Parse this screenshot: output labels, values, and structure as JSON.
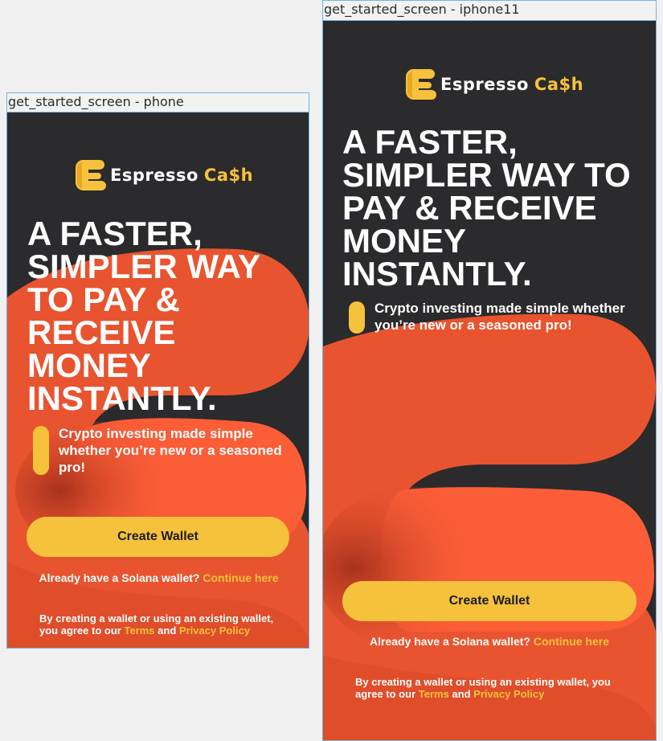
{
  "colors": {
    "accent": "#f6c23c",
    "background": "#2b2a2c",
    "wave": "#e8542f"
  },
  "frames": {
    "phone": {
      "label": "get_started_screen - phone"
    },
    "iphone11": {
      "label": "get_started_screen - iphone11"
    }
  },
  "logo": {
    "word1": "Espresso",
    "word2": "Ca$h",
    "icon": "espresso-cash-logo-icon"
  },
  "phone": {
    "headline": [
      "A FASTER,",
      "SIMPLER WAY",
      "TO PAY &",
      "RECEIVE",
      "MONEY",
      "INSTANTLY."
    ],
    "tagline": [
      "Crypto investing made simple",
      "whether you’re new or a seasoned",
      "pro!"
    ],
    "terms_line1": "By creating a wallet or using an existing wallet,",
    "terms_line2_prefix": "you agree to our "
  },
  "iphone11": {
    "headline": [
      "A FASTER,",
      "SIMPLER WAY TO",
      "PAY & RECEIVE",
      "MONEY",
      "INSTANTLY."
    ],
    "tagline": [
      "Crypto investing made simple whether",
      "you’re new or a seasoned pro!"
    ],
    "terms_line1": "By creating a wallet or using an existing wallet, you",
    "terms_line2_prefix": "agree to our "
  },
  "create_wallet_label": "Create Wallet",
  "already_text": "Already have a Solana wallet? ",
  "continue_link": "Continue here",
  "terms_link": "Terms",
  "and_text": " and ",
  "privacy_link": "Privacy Policy"
}
